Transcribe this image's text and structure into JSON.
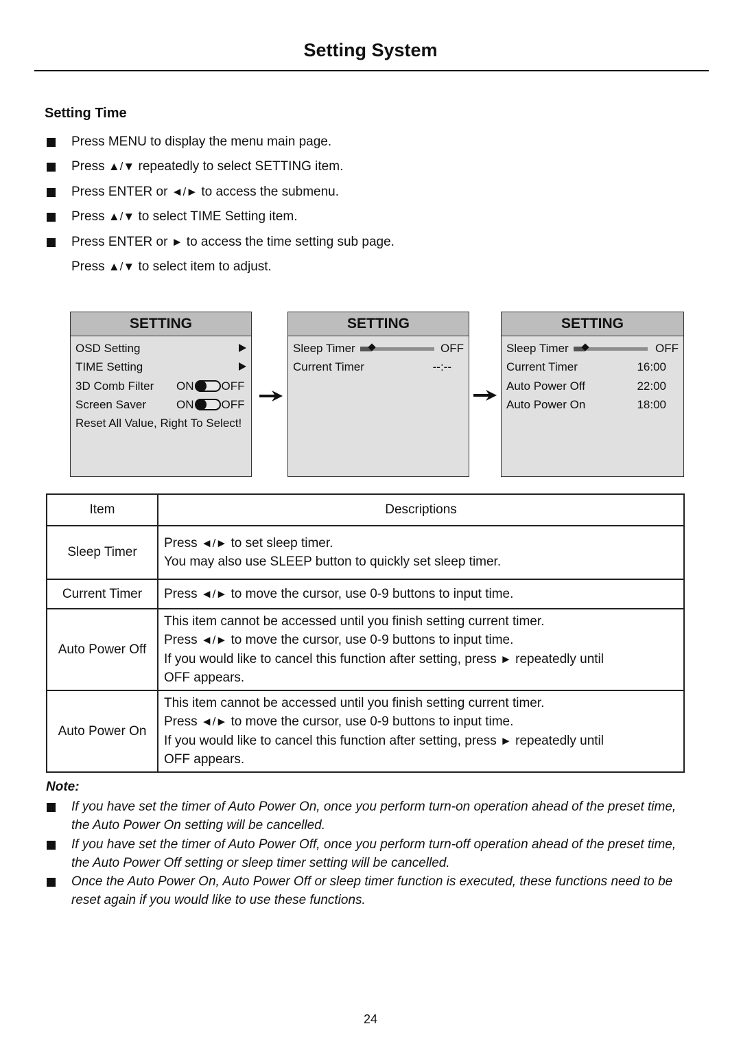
{
  "header": {
    "title": "Setting System"
  },
  "section": {
    "heading": "Setting Time",
    "steps": [
      {
        "pre": "Press MENU to display the menu main page.",
        "glyph": "",
        "post": "",
        "bullet": true
      },
      {
        "pre": "Press ",
        "glyph": "▲/▼",
        "post": " repeatedly to select SETTING item.",
        "bullet": true
      },
      {
        "pre": "Press ENTER or ",
        "glyph": "◄/►",
        "post": " to access the submenu.",
        "bullet": true
      },
      {
        "pre": "Press ",
        "glyph": "▲/▼",
        "post": " to select TIME Setting item.",
        "bullet": true
      },
      {
        "pre": "Press ENTER or ",
        "glyph": "►",
        "post": " to access the time setting sub page.",
        "bullet": true
      },
      {
        "pre": "Press ",
        "glyph": "▲/▼",
        "post": " to select item to adjust.",
        "bullet": false
      }
    ]
  },
  "osd_menus": [
    {
      "title": "SETTING",
      "rows": [
        {
          "label": "OSD Setting",
          "type": "submenu-arrow"
        },
        {
          "label": "TIME Setting",
          "type": "submenu-arrow"
        },
        {
          "label": "3D Comb Filter",
          "type": "toggle",
          "on_label": "ON",
          "off_label": "OFF",
          "state": "ON"
        },
        {
          "label": "Screen Saver",
          "type": "toggle",
          "on_label": "ON",
          "off_label": "OFF",
          "state": "ON"
        },
        {
          "label": "Reset All Value, Right To Select!",
          "type": "text"
        }
      ]
    },
    {
      "title": "SETTING",
      "rows": [
        {
          "label": "Sleep Timer",
          "type": "slider",
          "value": "OFF",
          "level": 0.12
        },
        {
          "label": "Current Timer",
          "type": "value",
          "value": "--:--"
        }
      ]
    },
    {
      "title": "SETTING",
      "rows": [
        {
          "label": "Sleep Timer",
          "type": "slider",
          "value": "OFF",
          "level": 0.12
        },
        {
          "label": "Current Timer",
          "type": "value",
          "value": "16:00"
        },
        {
          "label": "Auto Power Off",
          "type": "value",
          "value": "22:00"
        },
        {
          "label": "Auto Power On",
          "type": "value",
          "value": "18:00"
        }
      ]
    }
  ],
  "table": {
    "headers": [
      "Item",
      "Descriptions"
    ],
    "rows": [
      {
        "item": "Sleep Timer",
        "lines": [
          [
            "Press ",
            "◄/►",
            " to set sleep timer."
          ],
          [
            "You may also use SLEEP button to quickly set sleep timer."
          ]
        ]
      },
      {
        "item": "Current Timer",
        "lines": [
          [
            "Press ",
            "◄/►",
            " to move the cursor, use 0-9 buttons to input time."
          ]
        ]
      },
      {
        "item": "Auto Power Off",
        "lines": [
          [
            "This item cannot be accessed until you finish setting current timer."
          ],
          [
            "Press ",
            "◄/►",
            "  to move the cursor, use 0-9 buttons to input time."
          ],
          [
            "If you would like to cancel this function after setting, press ",
            "►",
            " repeatedly until"
          ],
          [
            "OFF appears."
          ]
        ]
      },
      {
        "item": "Auto Power On",
        "lines": [
          [
            "This item cannot be accessed until you finish setting current timer."
          ],
          [
            "Press ",
            "◄/►",
            " to move the cursor, use 0-9 buttons to input time."
          ],
          [
            "If you would like to cancel this function after setting, press ",
            "►",
            " repeatedly until"
          ],
          [
            "OFF appears."
          ]
        ]
      }
    ]
  },
  "notes": {
    "title": "Note:",
    "items": [
      "If you have set the timer of Auto Power On, once you perform turn-on operation ahead of the preset time, the Auto Power On setting will be cancelled.",
      "If you have set the timer of Auto Power Off, once you perform turn-off operation ahead of the preset time, the Auto Power Off setting or sleep timer setting will be cancelled.",
      "Once the Auto Power On, Auto Power Off or sleep timer function is executed, these functions need to be reset again if you would like to use these functions."
    ]
  },
  "footer": {
    "page_number": "24"
  }
}
